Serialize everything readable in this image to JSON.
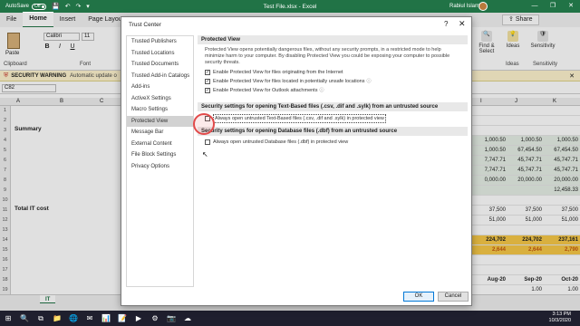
{
  "titlebar": {
    "autosave_label": "AutoSave",
    "autosave_state": "Off",
    "qat_icons": "💾 ↶ ↷ ▾",
    "doc_title": "Test File.xlsx  -  Excel",
    "user_name": "Rabiul Islam",
    "minimize": "—",
    "restore": "❐",
    "close": "✕"
  },
  "ribbon": {
    "tabs": [
      "File",
      "Home",
      "Insert",
      "Page Layout"
    ],
    "active_tab": "Home",
    "share_label": "Share",
    "paste_label": "Paste",
    "font_name": "Calibri",
    "font_size": "11",
    "format_buttons": [
      "B",
      "I",
      "U"
    ],
    "groups": [
      "Clipboard",
      "Font"
    ],
    "right_groups": [
      {
        "label": "Find &\nSelect",
        "icon": "🔍"
      },
      {
        "label": "Ideas",
        "icon": "💡"
      },
      {
        "label": "Sensitivity",
        "icon": "🛡"
      }
    ],
    "right_group_labels": [
      "Ideas",
      "Sensitivity"
    ]
  },
  "security_bar": {
    "title": "SECURITY WARNING",
    "message": "Automatic update o"
  },
  "formula_bar": {
    "namebox": "C82"
  },
  "grid": {
    "col_headers": [
      "A",
      "B",
      "C",
      "I",
      "J",
      "K"
    ],
    "row_numbers": [
      "1",
      "2",
      "3",
      "4",
      "5",
      "6",
      "7",
      "8",
      "9",
      "10",
      "11",
      "12",
      "13",
      "14",
      "15",
      "16",
      "17",
      "18",
      "19"
    ],
    "left_labels": [
      {
        "row": 3,
        "text": "Summary"
      },
      {
        "row": 15,
        "text": "Total IT cost"
      }
    ],
    "right_columns": [
      [
        "",
        "",
        "",
        "1,000.50",
        "1,000.50",
        "7,747.71",
        "7,747.71",
        "0,000.00",
        "",
        "",
        "37,500",
        "51,000",
        "",
        "224,702",
        "2,644",
        "",
        "",
        "Aug-20",
        ""
      ],
      [
        "",
        "",
        "",
        "1,000.50",
        "67,454.50",
        "45,747.71",
        "45,747.71",
        "20,000.00",
        "",
        "",
        "37,500",
        "51,000",
        "",
        "224,702",
        "2,644",
        "",
        "",
        "Sep-20",
        "1.00"
      ],
      [
        "",
        "",
        "",
        "1,000.50",
        "67,454.50",
        "45,747.71",
        "45,747.71",
        "20,000.00",
        "12,458.33",
        "",
        "37,500",
        "51,000",
        "",
        "237,161",
        "2,790",
        "",
        "",
        "Oct-20",
        "1.00"
      ]
    ]
  },
  "sheet_tab": "IT",
  "taskbar": {
    "icons": [
      "⊞",
      "🔍",
      "⧉",
      "📁",
      "🌐",
      "✉",
      "📊",
      "📝",
      "▶",
      "⚙",
      "📷",
      "☁"
    ],
    "time": "3:13 PM",
    "date": "10/3/2020"
  },
  "dialog": {
    "title": "Trust Center",
    "help": "?",
    "close": "✕",
    "nav": [
      "Trusted Publishers",
      "Trusted Locations",
      "Trusted Documents",
      "Trusted Add-in Catalogs",
      "Add-ins",
      "ActiveX Settings",
      "Macro Settings",
      "Protected View",
      "Message Bar",
      "External Content",
      "File Block Settings",
      "Privacy Options"
    ],
    "selected_nav": "Protected View",
    "protected_view": {
      "heading": "Protected View",
      "description": "Protected View opens potentially dangerous files, without any security prompts, in a restricted mode to help minimize harm to your computer. By disabling Protected View you could be exposing your computer to possible security threats.",
      "options": [
        {
          "label": "Enable Protected View for files originating from the Internet",
          "checked": true
        },
        {
          "label": "Enable Protected View for files located in potentially unsafe locations",
          "checked": true,
          "info": "ⓘ"
        },
        {
          "label": "Enable Protected View for Outlook attachments",
          "checked": true,
          "info": "ⓘ"
        }
      ]
    },
    "text_based": {
      "heading": "Security settings for opening Text-Based files (.csv, .dif and .sylk) from an untrusted source",
      "option": "Always open untrusted Text-Based files (.csv, .dif and .sylk) in protected view",
      "checked": false
    },
    "database": {
      "heading": "Security settings for opening Database files (.dbf) from an untrusted source",
      "option": "Always open untrusted Database files (.dbf) in protected view",
      "checked": false
    },
    "ok_label": "OK",
    "cancel_label": "Cancel"
  },
  "colors": {
    "excel_green": "#217346",
    "selected_nav_bg": "#d2d2d2",
    "highlight_circle": "#e24a4a"
  }
}
